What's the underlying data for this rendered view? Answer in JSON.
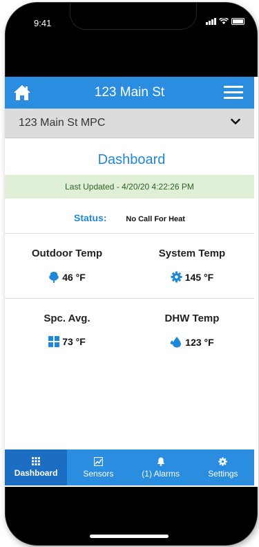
{
  "status_bar": {
    "time": "9:41"
  },
  "header": {
    "title": "123 Main St"
  },
  "site_selector": {
    "value": "123 Main St MPC"
  },
  "dashboard": {
    "title": "Dashboard",
    "last_updated": "Last Updated - 4/20/20 4:22:26 PM",
    "status_label": "Status:",
    "status_value": "No Call For Heat"
  },
  "metrics": {
    "outdoor_temp": {
      "label": "Outdoor Temp",
      "value": "46 °F",
      "icon": "tree-icon"
    },
    "system_temp": {
      "label": "System Temp",
      "value": "145 °F",
      "icon": "gear-icon"
    },
    "space_avg": {
      "label": "Spc. Avg.",
      "value": "73 °F",
      "icon": "grid-icon"
    },
    "dhw_temp": {
      "label": "DHW Temp",
      "value": "123 °F",
      "icon": "water-drop-icon"
    }
  },
  "tabs": [
    {
      "label": "Dashboard",
      "icon": "grid-icon",
      "active": true
    },
    {
      "label": "Sensors",
      "icon": "chart-icon",
      "active": false
    },
    {
      "label": "(1) Alarms",
      "icon": "bell-icon",
      "active": false
    },
    {
      "label": "Settings",
      "icon": "gear-icon",
      "active": false
    }
  ],
  "colors": {
    "brand_blue": "#2a8ddf",
    "active_tab": "#1b6ec2",
    "banner_green": "#dff0d6",
    "accent_text": "#1f87d8"
  }
}
